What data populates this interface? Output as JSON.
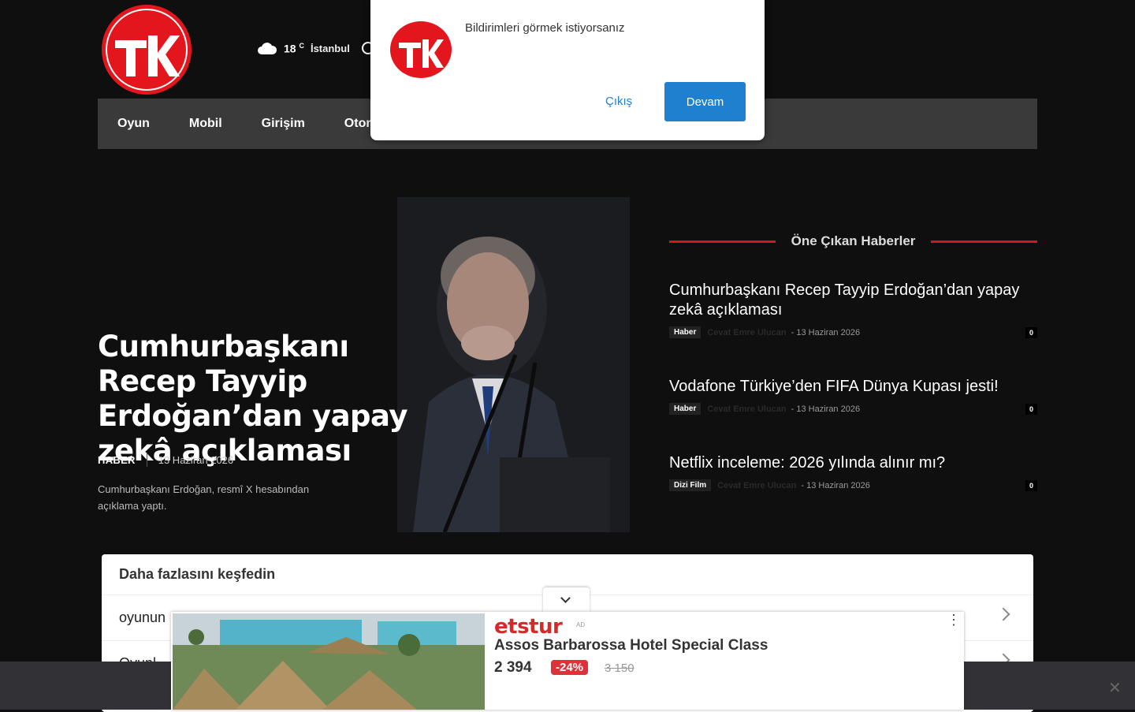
{
  "header": {
    "logo_text": "TK",
    "weather": {
      "temp": "18",
      "unit": "C",
      "city": "İstanbul",
      "icon": "cloud-icon"
    }
  },
  "nav": {
    "items": [
      {
        "label": "Oyun"
      },
      {
        "label": "Mobil"
      },
      {
        "label": "Girişim"
      },
      {
        "label": "Otom"
      }
    ]
  },
  "hero": {
    "title": "Cumhurbaşkanı Recep Tayyip Erdoğan’dan yapay zekâ açıklaması",
    "category": "HABER",
    "date": "13 Haziran 2026",
    "excerpt": "Cumhurbaşkanı Erdoğan, resmî X hesabından açıklama yaptı."
  },
  "featured": {
    "title": "Öne Çıkan Haberler",
    "accent": "#d3171f",
    "items": [
      {
        "title": "Cumhurbaşkanı Recep Tayyip Erdoğan’dan yapay zekâ açıklaması",
        "category": "Haber",
        "author": "Cevat Emre Ulucan",
        "date": "13 Haziran 2026",
        "comments": "0"
      },
      {
        "title": "Vodafone Türkiye’den FIFA Dünya Kupası jesti!",
        "category": "Haber",
        "author": "Cevat Emre Ulucan",
        "date": "13 Haziran 2026",
        "comments": "0"
      },
      {
        "title": "Netflix inceleme: 2026 yılında alınır mı?",
        "category": "Dizi Film",
        "author": "Cevat Emre Ulucan",
        "date": "13 Haziran 2026",
        "comments": "0"
      }
    ]
  },
  "explore": {
    "title": "Daha fazlasını keşfedin",
    "items": [
      {
        "label": "oyunun"
      },
      {
        "label": "Oyunl"
      }
    ]
  },
  "ad": {
    "brand": "etstur",
    "tag": "AD",
    "title": "Assos Barbarossa Hotel Special Class",
    "price": "2 394",
    "discount": "-24%",
    "old_price": "3 150"
  },
  "popup": {
    "message": "Bildirimleri görmek istiyorsanız",
    "exit_label": "Çıkış",
    "continue_label": "Devam"
  },
  "bottom_bar": {
    "close": "✕"
  }
}
